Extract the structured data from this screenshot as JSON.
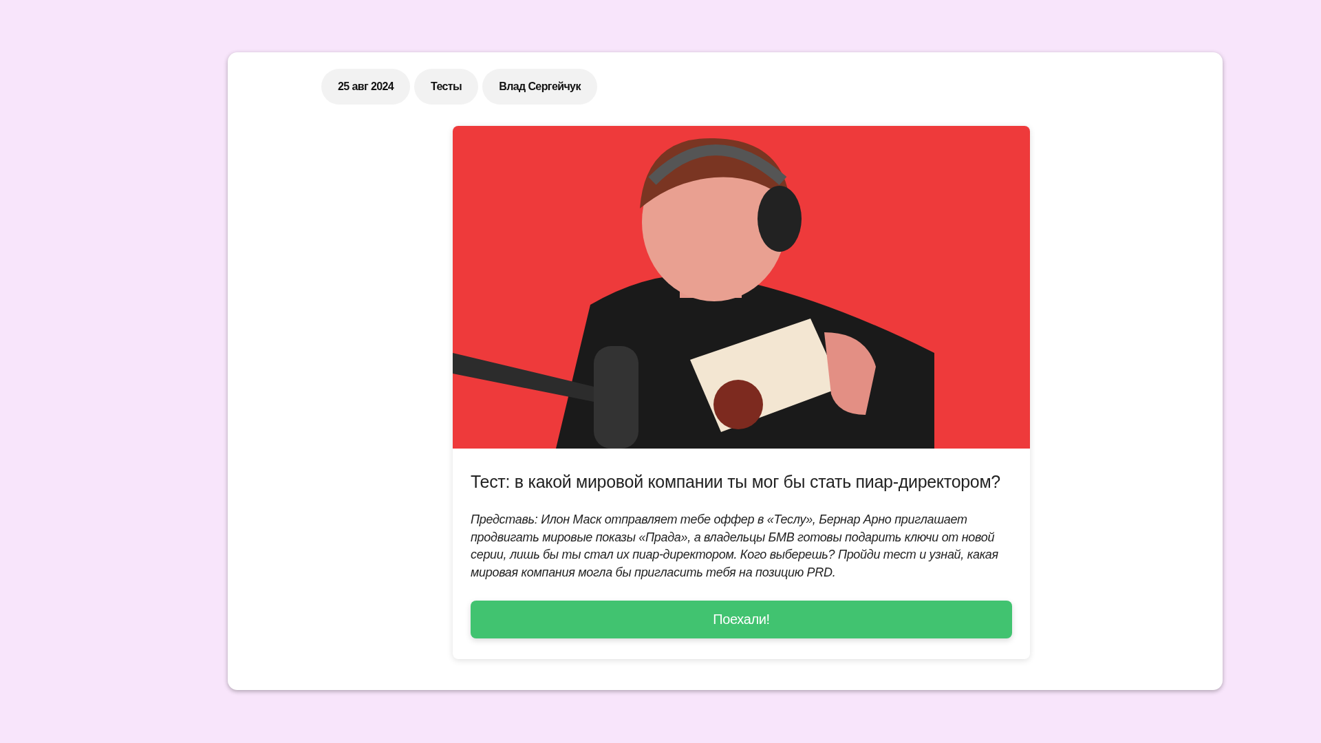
{
  "tags": [
    {
      "label": "25 авг 2024"
    },
    {
      "label": "Тесты"
    },
    {
      "label": "Влад Сергейчук"
    }
  ],
  "post": {
    "title": "Тест: в какой мировой компании ты мог бы стать пиар-директором?",
    "description": "Представь: Илон Маск отправляет тебе оффер в «Теслу», Бернар Арно приглашает продвигать мировые показы «Прада», а владельцы БМВ готовы подарить ключи от новой серии, лишь бы ты стал их пиар-директором. Кого выберешь? Пройди тест и узнай, какая мировая компания могла бы пригласить тебя на позицию PRD.",
    "button": "Поехали!"
  }
}
